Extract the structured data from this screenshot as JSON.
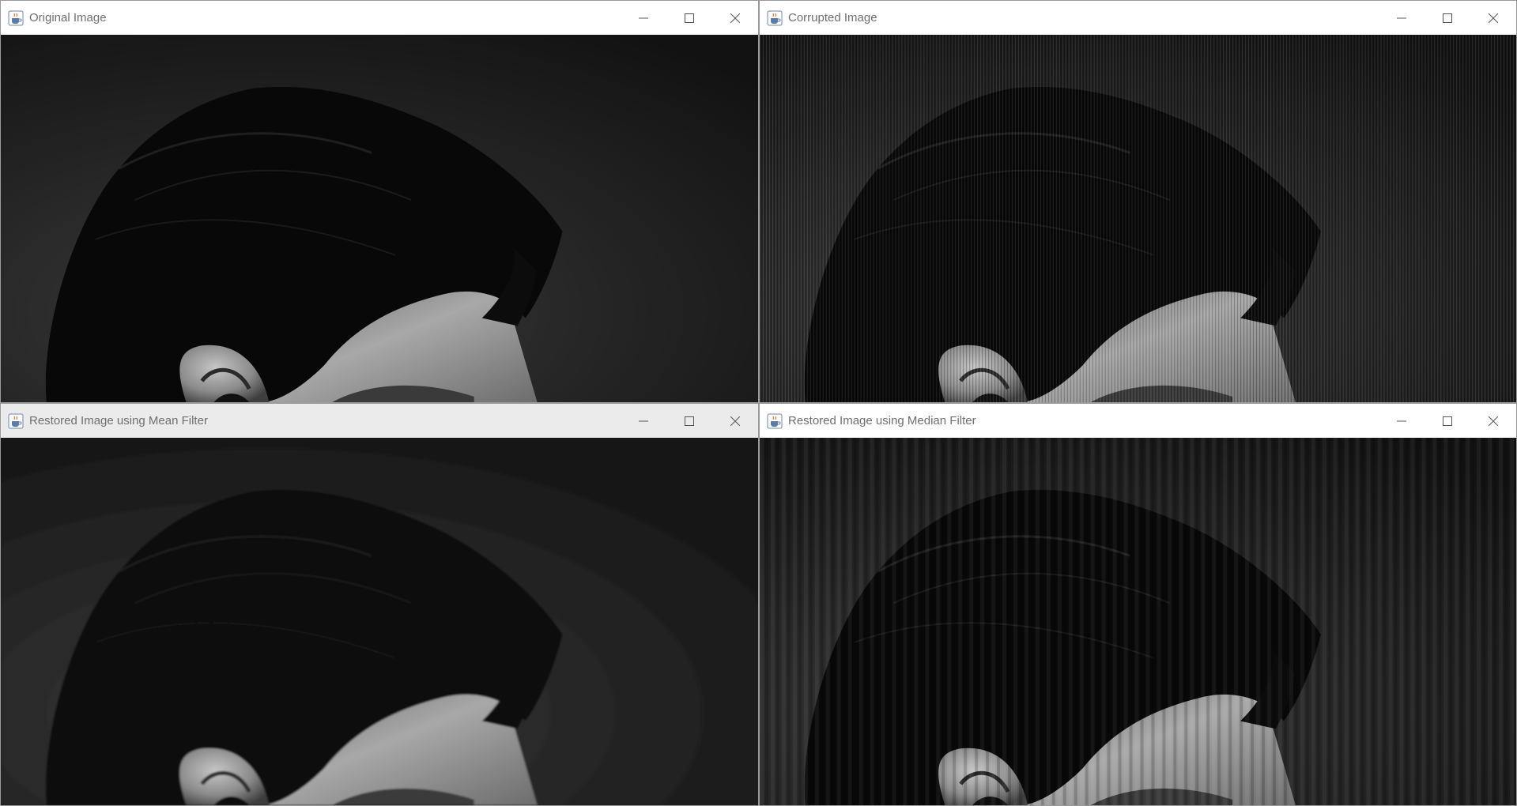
{
  "windows": [
    {
      "id": "original",
      "title": "Original Image",
      "image_kind": "clean"
    },
    {
      "id": "corrupted",
      "title": "Corrupted Image",
      "image_kind": "striped"
    },
    {
      "id": "mean",
      "title": "Restored Image using Mean Filter",
      "image_kind": "smooth"
    },
    {
      "id": "median",
      "title": "Restored Image using Median Filter",
      "image_kind": "soft-striped"
    }
  ],
  "icons": {
    "app": "java-cup-icon",
    "minimize": "minimize-icon",
    "maximize": "maximize-icon",
    "close": "close-icon"
  },
  "colors": {
    "titlebar_active": "#ffffff",
    "titlebar_inactive": "#ebebeb",
    "title_text": "#6f6f6f",
    "image_background": "#1a1a1a",
    "hair": "#080808",
    "skin": "#8f8f8f"
  }
}
